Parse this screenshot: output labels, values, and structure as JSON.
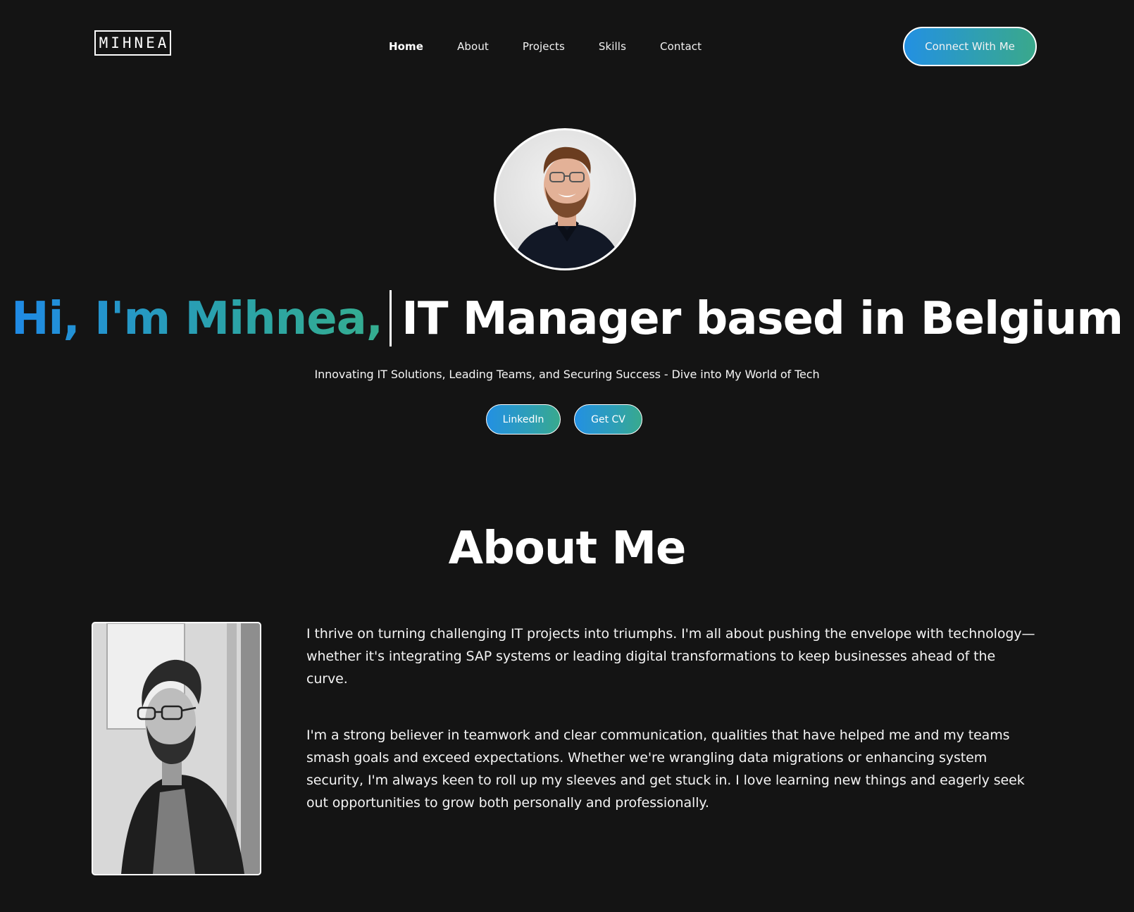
{
  "nav": {
    "logo_text": "MIHNEA",
    "links": [
      "Home",
      "About",
      "Projects",
      "Skills",
      "Contact"
    ],
    "cta": "Connect With Me"
  },
  "hero": {
    "headline_gradient": "Hi, I'm Mihnea,",
    "headline_white": "IT Manager based in Belgium",
    "subtitle": "Innovating IT Solutions, Leading Teams, and Securing Success - Dive into My World of Tech",
    "buttons": [
      "LinkedIn",
      "Get CV"
    ]
  },
  "about": {
    "title": "About Me",
    "paragraphs": [
      "I thrive on turning challenging IT projects into triumphs. I'm all about pushing the envelope with technology—whether it's integrating SAP systems or leading digital transformations to keep businesses ahead of the curve.",
      "I'm a strong believer in teamwork and clear communication, qualities that have helped me and my teams smash goals and exceed expectations. Whether we're wrangling data migrations or enhancing system security, I'm always keen to roll up my sleeves and get stuck in. I love learning new things and eagerly seek out opportunities to grow both personally and professionally."
    ]
  },
  "colors": {
    "background": "#141414",
    "gradient_start": "#1f8ae6",
    "gradient_end": "#38a98d",
    "text": "#ffffff"
  }
}
